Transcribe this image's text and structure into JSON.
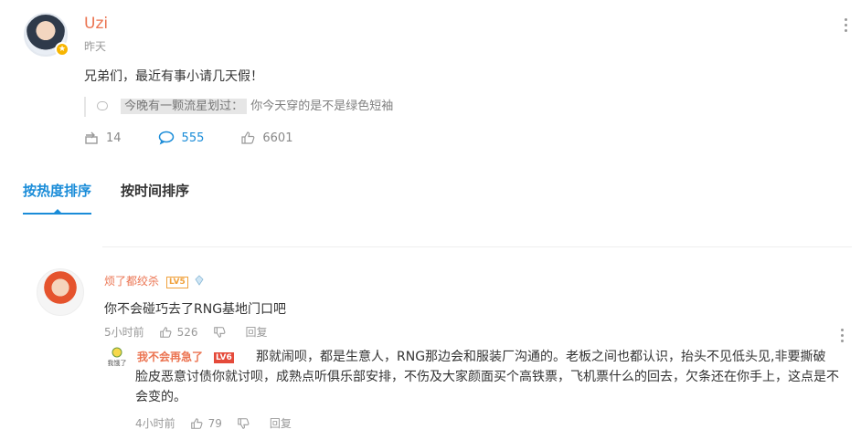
{
  "post": {
    "username": "Uzi",
    "time": "昨天",
    "text": "兄弟们，最近有事小请几天假！",
    "quote_highlight": "今晚有一颗流星划过：",
    "quote_text": "你今天穿的是不是绿色短袖",
    "reposts": "14",
    "comments": "555",
    "likes": "6601"
  },
  "tabs": [
    {
      "label": "按热度排序",
      "active": true
    },
    {
      "label": "按时间排序",
      "active": false
    }
  ],
  "comment": {
    "username": "烦了都绞杀",
    "level_badge": "LV5",
    "text": "你不会碰巧去了RNG基地门口吧",
    "time": "5小时前",
    "likes": "526",
    "reply_label": "回复"
  },
  "reply": {
    "avatar_text": "我饿了",
    "username": "我不会再急了",
    "level_badge": "LV6",
    "text_line1": "那就闹呗，都是生意人，RNG那边会和服装厂沟通的。老板之间也都认识，抬头不见低头见,非要撕破",
    "text_rest": "脸皮恶意讨债你就讨呗，成熟点听俱乐部安排，不伤及大家颜面买个高铁票，飞机票什么的回去，欠条还在你手上，这点是不会变的。",
    "time": "4小时前",
    "likes": "79",
    "reply_label": "回复"
  },
  "colors": {
    "accent_blue": "#1a8cd8",
    "username_orange": "#eb7350",
    "muted": "#999999"
  }
}
